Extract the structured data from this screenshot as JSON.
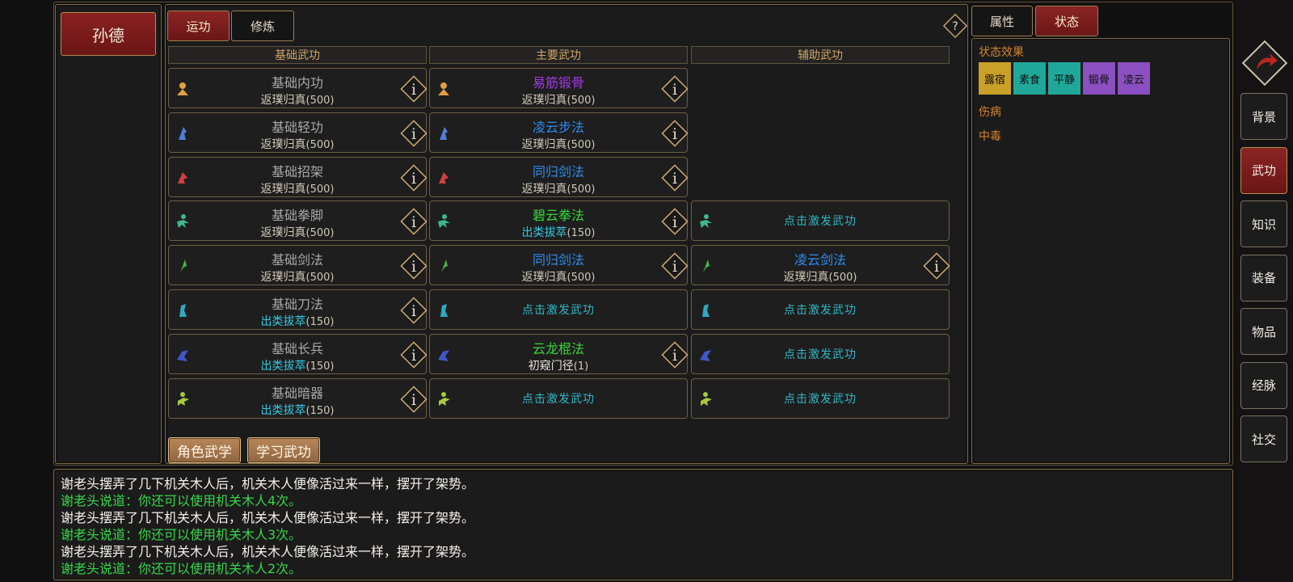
{
  "character": {
    "name": "孙德"
  },
  "tabs": [
    {
      "label": "运功",
      "active": true
    },
    {
      "label": "修炼",
      "active": false
    }
  ],
  "help_icon": "question-icon",
  "columns": [
    {
      "header": "基础武功",
      "slots": [
        {
          "name": "基础内功",
          "name_color": "#a8a8a8",
          "rank": "返璞归真",
          "rank_color": "#cfc8b9",
          "level": "(500)",
          "icon": "neigong-icon",
          "icon_color": "#e0a040"
        },
        {
          "name": "基础轻功",
          "name_color": "#a8a8a8",
          "rank": "返璞归真",
          "rank_color": "#cfc8b9",
          "level": "(500)",
          "icon": "qinggong-icon",
          "icon_color": "#4f7fd8"
        },
        {
          "name": "基础招架",
          "name_color": "#a8a8a8",
          "rank": "返璞归真",
          "rank_color": "#cfc8b9",
          "level": "(500)",
          "icon": "zhaojia-icon",
          "icon_color": "#d04040"
        },
        {
          "name": "基础拳脚",
          "name_color": "#a8a8a8",
          "rank": "返璞归真",
          "rank_color": "#cfc8b9",
          "level": "(500)",
          "icon": "quanjiao-icon",
          "icon_color": "#3fb88d"
        },
        {
          "name": "基础剑法",
          "name_color": "#a8a8a8",
          "rank": "返璞归真",
          "rank_color": "#cfc8b9",
          "level": "(500)",
          "icon": "jianfa-icon",
          "icon_color": "#49b14d"
        },
        {
          "name": "基础刀法",
          "name_color": "#a8a8a8",
          "rank": "出类拔萃",
          "rank_color": "#35c7e0",
          "level": "(150)",
          "icon": "daofa-icon",
          "icon_color": "#2fa8c4"
        },
        {
          "name": "基础长兵",
          "name_color": "#a8a8a8",
          "rank": "出类拔萃",
          "rank_color": "#35c7e0",
          "level": "(150)",
          "icon": "changbing-icon",
          "icon_color": "#3f58c8"
        },
        {
          "name": "基础暗器",
          "name_color": "#a8a8a8",
          "rank": "出类拔萃",
          "rank_color": "#35c7e0",
          "level": "(150)",
          "icon": "anqi-icon",
          "icon_color": "#a8c840"
        }
      ]
    },
    {
      "header": "主要武功",
      "slots": [
        {
          "name": "易筋锻骨",
          "name_color": "#a23ae8",
          "rank": "返璞归真",
          "rank_color": "#cfc8b9",
          "level": "(500)",
          "icon": "neigong-icon",
          "icon_color": "#e0a040"
        },
        {
          "name": "凌云步法",
          "name_color": "#2d8ef0",
          "rank": "返璞归真",
          "rank_color": "#cfc8b9",
          "level": "(500)",
          "icon": "qinggong-icon",
          "icon_color": "#4f7fd8"
        },
        {
          "name": "同归剑法",
          "name_color": "#2d8ef0",
          "rank": "返璞归真",
          "rank_color": "#cfc8b9",
          "level": "(500)",
          "icon": "zhaojia-icon",
          "icon_color": "#d04040"
        },
        {
          "name": "碧云拳法",
          "name_color": "#38d83a",
          "rank": "出类拔萃",
          "rank_color": "#35c7e0",
          "level": "(150)",
          "icon": "quanjiao-icon",
          "icon_color": "#3fb88d"
        },
        {
          "name": "同归剑法",
          "name_color": "#2d8ef0",
          "rank": "返璞归真",
          "rank_color": "#cfc8b9",
          "level": "(500)",
          "icon": "jianfa-icon",
          "icon_color": "#49b14d"
        },
        {
          "empty": "点击激发武功",
          "icon": "daofa-icon",
          "icon_color": "#2fa8c4"
        },
        {
          "name": "云龙棍法",
          "name_color": "#38d83a",
          "rank": "初窥门径",
          "rank_color": "#e8e4dc",
          "level": "(1)",
          "icon": "changbing-icon",
          "icon_color": "#3f58c8"
        },
        {
          "empty": "点击激发武功",
          "icon": "anqi-icon",
          "icon_color": "#a8c840"
        }
      ]
    },
    {
      "header": "辅助武功",
      "slots": [
        null,
        null,
        null,
        {
          "empty": "点击激发武功",
          "icon": "quanjiao-icon",
          "icon_color": "#3fb88d"
        },
        {
          "name": "凌云剑法",
          "name_color": "#2d8ef0",
          "rank": "返璞归真",
          "rank_color": "#cfc8b9",
          "level": "(500)",
          "icon": "jianfa-icon",
          "icon_color": "#49b14d"
        },
        {
          "empty": "点击激发武功",
          "icon": "daofa-icon",
          "icon_color": "#2fa8c4"
        },
        {
          "empty": "点击激发武功",
          "icon": "changbing-icon",
          "icon_color": "#3f58c8"
        },
        {
          "empty": "点击激发武功",
          "icon": "anqi-icon",
          "icon_color": "#a8c840"
        }
      ]
    }
  ],
  "bottom_buttons": {
    "role_martial": "角色武学",
    "learn_martial": "学习武功"
  },
  "right_tabs": [
    {
      "label": "属性",
      "active": false
    },
    {
      "label": "状态",
      "active": true
    }
  ],
  "status": {
    "effects_label": "状态效果",
    "effects": [
      {
        "label": "露宿",
        "color": "#c9a128"
      },
      {
        "label": "素食",
        "color": "#1fa89a"
      },
      {
        "label": "平静",
        "color": "#1fa89a"
      },
      {
        "label": "锻骨",
        "color": "#8a4fc0"
      },
      {
        "label": "凌云",
        "color": "#8a4fc0"
      }
    ],
    "injury_label": "伤病",
    "poison_label": "中毒"
  },
  "side_nav": [
    {
      "label": "背景",
      "active": false
    },
    {
      "label": "武功",
      "active": true
    },
    {
      "label": "知识",
      "active": false
    },
    {
      "label": "装备",
      "active": false
    },
    {
      "label": "物品",
      "active": false
    },
    {
      "label": "经脉",
      "active": false
    },
    {
      "label": "社交",
      "active": false
    }
  ],
  "log": [
    {
      "text": "谢老头摆弄了几下机关木人后，机关木人便像活过来一样，摆开了架势。",
      "color": "white"
    },
    {
      "text": "谢老头说道：你还可以使用机关木人4次。",
      "color": "green"
    },
    {
      "text": "谢老头摆弄了几下机关木人后，机关木人便像活过来一样，摆开了架势。",
      "color": "white"
    },
    {
      "text": "谢老头说道：你还可以使用机关木人3次。",
      "color": "green"
    },
    {
      "text": "谢老头摆弄了几下机关木人后，机关木人便像活过来一样，摆开了架势。",
      "color": "white"
    },
    {
      "text": "谢老头说道：你还可以使用机关木人2次。",
      "color": "green"
    }
  ],
  "colors": {
    "accent_red": "#7a1c1c",
    "gold_border": "#9a8053",
    "empty_slot_text": "#2fb8c4"
  }
}
